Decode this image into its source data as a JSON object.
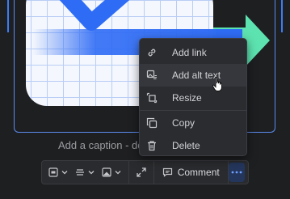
{
  "editor": {
    "caption_placeholder": "Add a caption - do"
  },
  "context_menu": {
    "items": [
      {
        "label": "Add link",
        "icon": "link-icon"
      },
      {
        "label": "Add alt text",
        "icon": "alt-text-icon"
      },
      {
        "label": "Resize",
        "icon": "resize-icon"
      },
      {
        "label": "Copy",
        "icon": "copy-icon"
      },
      {
        "label": "Delete",
        "icon": "trash-icon"
      }
    ],
    "hovered_index": 1
  },
  "toolbar": {
    "comment_label": "Comment",
    "buttons": [
      "layout-icon",
      "align-icon",
      "image-style-icon",
      "expand-icon",
      "comment-icon",
      "more-icon"
    ]
  },
  "colors": {
    "background": "#1e1f21",
    "selection": "#3d7cf5",
    "menu_bg": "#2b2c30",
    "menu_hover": "#36373c",
    "accent_green": "#5de3b0",
    "accent_blue": "#2f6cf5"
  }
}
